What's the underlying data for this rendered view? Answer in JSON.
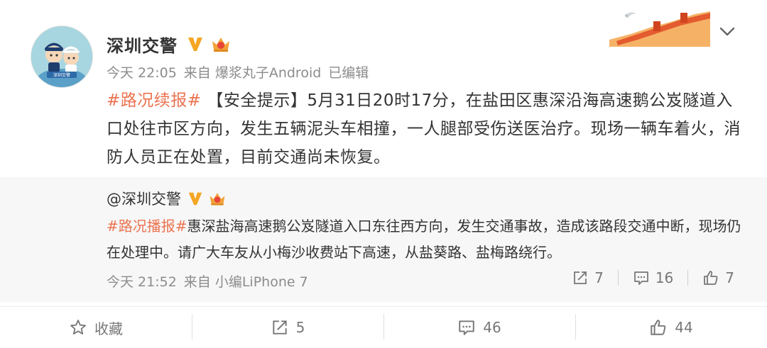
{
  "author": {
    "name": "深圳交警",
    "avatar_badge": "深圳交警"
  },
  "meta": {
    "time": "今天 22:05",
    "source": "来自 爆浆丸子Android",
    "edited": "已编辑"
  },
  "post": {
    "topic": "#路况续报#",
    "text": " 【安全提示】5月31日20时17分，在盐田区惠深沿海高速鹅公岌隧道入口处往市区方向，发生五辆泥头车相撞，一人腿部受伤送医治疗。现场一辆车着火，消防人员正在处置，目前交通尚未恢复。"
  },
  "quoted": {
    "author": "@深圳交警",
    "topic": "#路况播报#",
    "text": "惠深盐海高速鹅公岌隧道入口东往西方向，发生交通事故，造成该路段交通中断，现场仍在处理中。请广大车友从小梅沙收费站下高速，从盐葵路、盐梅路绕行。",
    "time": "今天 21:52",
    "source": "来自 小编LiPhone 7",
    "reposts": "7",
    "comments": "16",
    "likes": "7"
  },
  "footer": {
    "favorite_label": "收藏",
    "reposts": "5",
    "comments": "46",
    "likes": "44"
  },
  "colors": {
    "topic": "#eb7350",
    "verified": "#f5a623",
    "quote_bg": "#f7f7f7"
  },
  "icons": [
    "verified-icon",
    "crown-icon",
    "chevron-down-icon",
    "repost-icon",
    "comment-icon",
    "like-icon",
    "star-icon"
  ]
}
